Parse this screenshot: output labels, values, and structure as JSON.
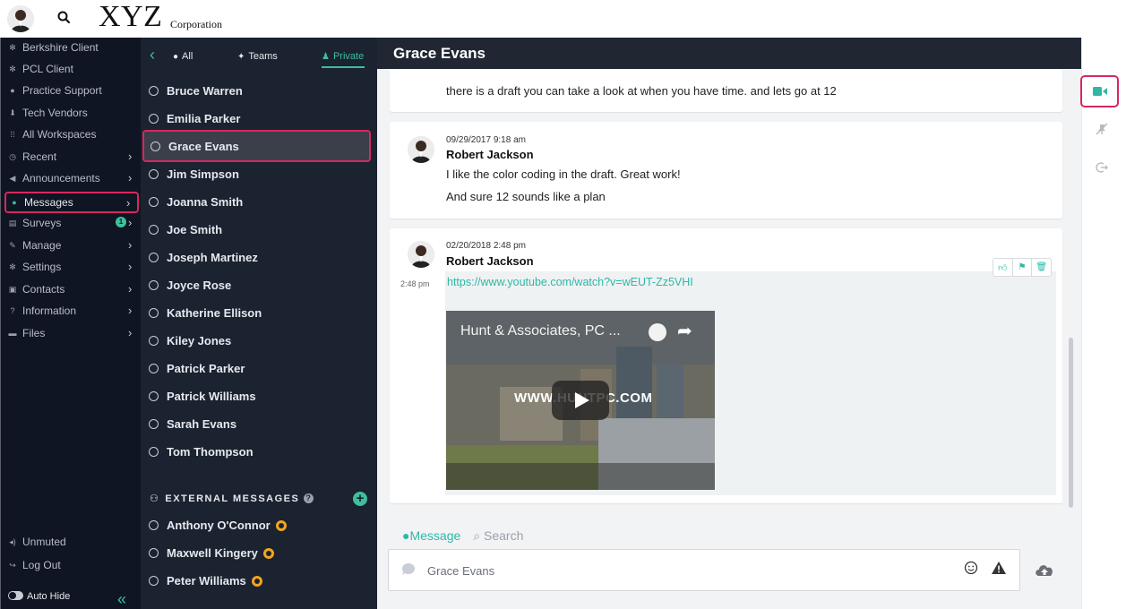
{
  "brand": {
    "name": "XYZ",
    "suffix": "Corporation"
  },
  "leftnav": {
    "items": [
      {
        "label": "Berkshire Client",
        "icon": "gear-icon",
        "chevron": false
      },
      {
        "label": "PCL Client",
        "icon": "gear-icon",
        "chevron": false
      },
      {
        "label": "Practice Support",
        "icon": "globe-icon",
        "chevron": false
      },
      {
        "label": "Tech Vendors",
        "icon": "pin-icon",
        "chevron": false
      },
      {
        "label": "All Workspaces",
        "icon": "grid-icon",
        "chevron": false
      },
      {
        "label": "Recent",
        "icon": "clock-icon",
        "chevron": true
      },
      {
        "label": "Announcements",
        "icon": "megaphone-icon",
        "chevron": true
      },
      {
        "label": "Messages",
        "icon": "chat-icon",
        "chevron": true,
        "active": true
      },
      {
        "label": "Surveys",
        "icon": "clipboard-icon",
        "chevron": true,
        "badge": "1"
      },
      {
        "label": "Manage",
        "icon": "pencil-icon",
        "chevron": true
      },
      {
        "label": "Settings",
        "icon": "gear-icon",
        "chevron": true
      },
      {
        "label": "Contacts",
        "icon": "contact-card-icon",
        "chevron": true
      },
      {
        "label": "Information",
        "icon": "question-icon",
        "chevron": true
      },
      {
        "label": "Files",
        "icon": "folder-icon",
        "chevron": true
      }
    ],
    "footer": {
      "unmuted": "Unmuted",
      "logout": "Log Out",
      "autohide": "Auto Hide"
    }
  },
  "contacts": {
    "tabs": [
      {
        "label": "All"
      },
      {
        "label": "Teams"
      },
      {
        "label": "Private",
        "active": true
      }
    ],
    "list": [
      "Bruce Warren",
      "Emilia Parker",
      "Grace Evans",
      "Jim Simpson",
      "Joanna Smith",
      "Joe Smith",
      "Joseph Martinez",
      "Joyce Rose",
      "Katherine Ellison",
      "Kiley Jones",
      "Patrick Parker",
      "Patrick Williams",
      "Sarah Evans",
      "Tom Thompson"
    ],
    "selected": "Grace Evans",
    "external_header": "EXTERNAL MESSAGES",
    "external": [
      "Anthony O'Connor",
      "Maxwell Kingery",
      "Peter Williams"
    ]
  },
  "chat": {
    "title": "Grace Evans",
    "messages": [
      {
        "text": "there is a draft you can take a look at when you have time. and lets go at 12"
      },
      {
        "timestamp": "09/29/2017 9:18 am",
        "author": "Robert Jackson",
        "lines": [
          "I like the color coding in the draft. Great work!",
          "And sure 12 sounds like a plan"
        ]
      },
      {
        "timestamp": "02/20/2018 2:48 pm",
        "author": "Robert Jackson",
        "time_short": "2:48 pm",
        "link": "https://www.youtube.com/watch?v=wEUT-Zz5VHI",
        "video": {
          "title": "Hunt & Associates, PC ...",
          "watermark": "WWW.HUNTPC.COM"
        }
      }
    ],
    "composer": {
      "tab_message": "Message",
      "tab_search": "Search",
      "placeholder": "Grace Evans"
    }
  },
  "colors": {
    "accent": "#3fbf9c",
    "highlight": "#d6285e",
    "nav_bg": "#0f1522",
    "panel_bg": "#1b2230"
  }
}
